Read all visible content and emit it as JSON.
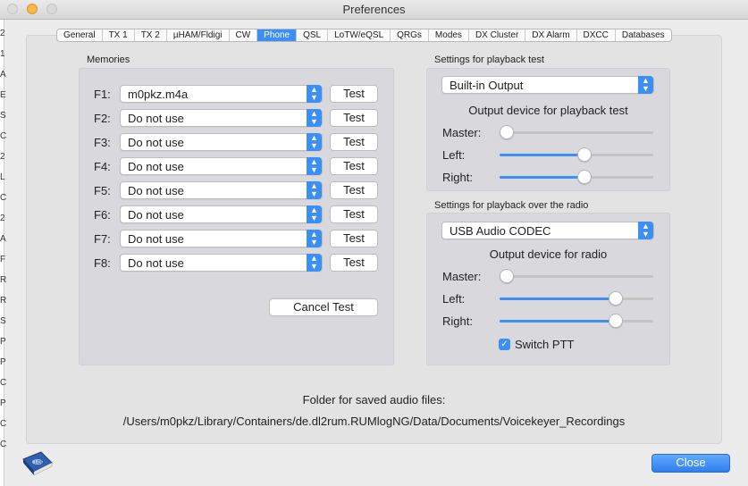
{
  "window": {
    "title": "Preferences"
  },
  "tabs": [
    "General",
    "TX 1",
    "TX 2",
    "µHAM/Fldigi",
    "CW",
    "Phone",
    "QSL",
    "LoTW/eQSL",
    "QRGs",
    "Modes",
    "DX Cluster",
    "DX Alarm",
    "DXCC",
    "Databases"
  ],
  "active_tab": "Phone",
  "memories": {
    "title": "Memories",
    "items": [
      {
        "label": "F1:",
        "value": "m0pkz.m4a",
        "test": "Test"
      },
      {
        "label": "F2:",
        "value": "Do not use",
        "test": "Test"
      },
      {
        "label": "F3:",
        "value": "Do not use",
        "test": "Test"
      },
      {
        "label": "F4:",
        "value": "Do not use",
        "test": "Test"
      },
      {
        "label": "F5:",
        "value": "Do not use",
        "test": "Test"
      },
      {
        "label": "F6:",
        "value": "Do not use",
        "test": "Test"
      },
      {
        "label": "F7:",
        "value": "Do not use",
        "test": "Test"
      },
      {
        "label": "F8:",
        "value": "Do not use",
        "test": "Test"
      }
    ],
    "cancel_test": "Cancel Test"
  },
  "playback_test": {
    "title": "Settings for playback test",
    "device": "Built-in Output",
    "subtitle": "Output device for playback test",
    "master_label": "Master:",
    "master": 0.0,
    "left_label": "Left:",
    "left": 0.56,
    "right_label": "Right:",
    "right": 0.56
  },
  "playback_radio": {
    "title": "Settings for playback over the radio",
    "device": "USB Audio CODEC",
    "subtitle": "Output device for radio",
    "master_label": "Master:",
    "master": 0.0,
    "left_label": "Left:",
    "left": 0.78,
    "right_label": "Right:",
    "right": 0.78,
    "switch_ptt_label": "Switch PTT",
    "switch_ptt": true
  },
  "folder": {
    "label": "Folder for saved audio files:",
    "path": "/Users/m0pkz/Library/Containers/de.dl2rum.RUMlogNG/Data/Documents/Voicekeyer_Recordings"
  },
  "close_label": "Close",
  "left_edge_chars": [
    "2",
    "1",
    "A",
    "E",
    "S",
    "C",
    "2",
    "L",
    "C",
    "2",
    "A",
    "F",
    "R",
    "R",
    "S",
    "P",
    "P",
    "C",
    "P",
    "C",
    "C"
  ],
  "colors": {
    "accent": "#3b8ff5",
    "window_bg": "#ececec",
    "group_bg": "#d9d9dd"
  }
}
